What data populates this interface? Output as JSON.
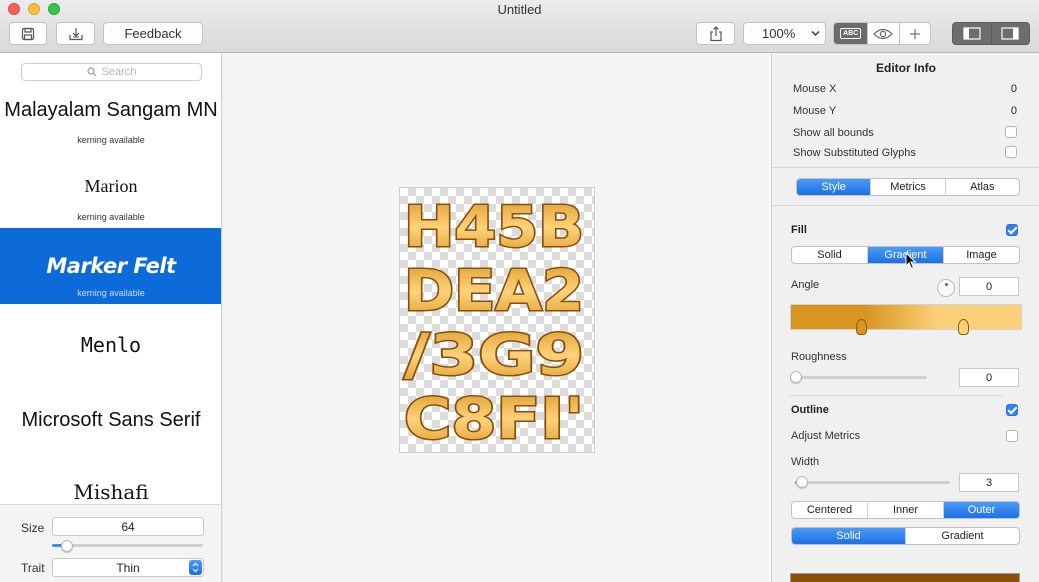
{
  "window": {
    "title": "Untitled"
  },
  "toolbar": {
    "feedback_label": "Feedback",
    "zoom_value": "100%",
    "abc_label": "ABC"
  },
  "sidebar": {
    "search_placeholder": "Search",
    "fonts": [
      {
        "name": "Malayalam Sangam MN",
        "subtitle": "kerning available"
      },
      {
        "name": "Marion",
        "subtitle": "kerning available"
      },
      {
        "name": "Marker Felt",
        "subtitle": "kerning available"
      },
      {
        "name": "Menlo",
        "subtitle": ""
      },
      {
        "name": "Microsoft Sans Serif",
        "subtitle": ""
      },
      {
        "name": "Mishafi",
        "subtitle": ""
      }
    ],
    "selected_font": "Marker Felt",
    "size_label": "Size",
    "size_value": "64",
    "size_slider_fraction": 0.1,
    "trait_label": "Trait",
    "trait_value": "Thin"
  },
  "preview": {
    "glyph_rows": [
      "H45B",
      "DEA2",
      "/3G9",
      "C8FI'"
    ],
    "fill_color_light": "#ffd27a",
    "fill_color_dark": "#d99a2a",
    "outline_color": "#8a4f08"
  },
  "inspector": {
    "title": "Editor Info",
    "mouse_x_label": "Mouse X",
    "mouse_x_value": "0",
    "mouse_y_label": "Mouse Y",
    "mouse_y_value": "0",
    "show_bounds_label": "Show all bounds",
    "show_substituted_label": "Show Substituted Glyphs",
    "tabs": [
      "Style",
      "Metrics",
      "Atlas"
    ],
    "active_tab": "Style",
    "fill": {
      "label": "Fill",
      "enabled": true,
      "modes": [
        "Solid",
        "Gradient",
        "Image"
      ],
      "active_mode": "Gradient",
      "angle_label": "Angle",
      "angle_value": "0",
      "gradient_colors": [
        "#d8951f",
        "#fdd07a"
      ],
      "roughness_label": "Roughness",
      "roughness_value": "0"
    },
    "outline": {
      "label": "Outline",
      "enabled": true,
      "adjust_metrics_label": "Adjust Metrics",
      "width_label": "Width",
      "width_value": "3",
      "positions": [
        "Centered",
        "Inner",
        "Outer"
      ],
      "active_position": "Outer",
      "styles": [
        "Solid",
        "Gradient"
      ],
      "active_style": "Solid",
      "color_swatch": "#8a4f08"
    }
  }
}
